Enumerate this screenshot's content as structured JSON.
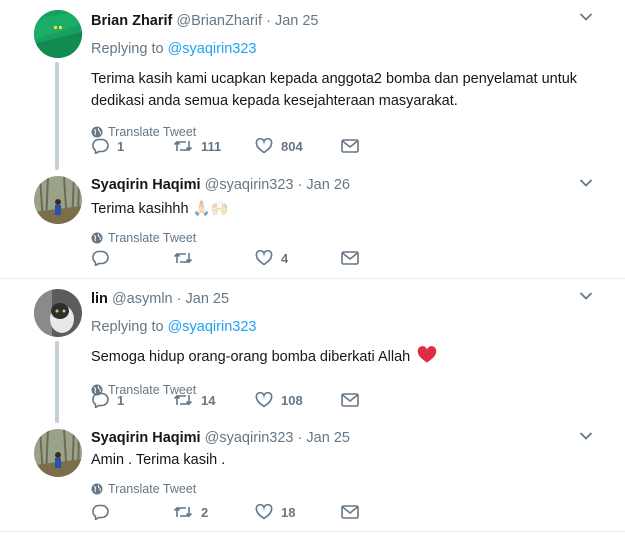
{
  "tweets": [
    {
      "name": "Brian Zharif",
      "handle": "@BrianZharif",
      "dot": "·",
      "time": "Jan 25",
      "reply_prefix": "Replying to",
      "reply_to": "@syaqirin323",
      "text": "Terima kasih kami ucapkan kepada anggota2 bomba dan penyelamat untuk dedikasi anda semua kepada kesejahteraan masyarakat.",
      "translate": "Translate Tweet",
      "replies": "1",
      "retweets": "111",
      "likes": "804"
    },
    {
      "name": "Syaqirin Haqimi",
      "handle": "@syaqirin323",
      "dot": "·",
      "time": "Jan 26",
      "text": "Terima kasihhh",
      "emoji": "🙏🏻🙌🏻",
      "translate": "Translate Tweet",
      "replies": "",
      "retweets": "",
      "likes": "4"
    },
    {
      "name": "lin",
      "handle": "@asymln",
      "dot": "·",
      "time": "Jan 25",
      "reply_prefix": "Replying to",
      "reply_to": "@syaqirin323",
      "text": "Semoga hidup orang-orang bomba diberkati Allah",
      "emoji": "❤️",
      "translate": "Translate Tweet",
      "replies": "1",
      "retweets": "14",
      "likes": "108"
    },
    {
      "name": "Syaqirin Haqimi",
      "handle": "@syaqirin323",
      "dot": "·",
      "time": "Jan 25",
      "text": "Amin . Terima kasih .",
      "translate": "Translate Tweet",
      "replies": "",
      "retweets": "2",
      "likes": "18"
    }
  ],
  "colors": {
    "link": "#1da1f2",
    "muted": "#657786",
    "thread_line": "#c4cfd6",
    "heart": "#e0245e"
  }
}
